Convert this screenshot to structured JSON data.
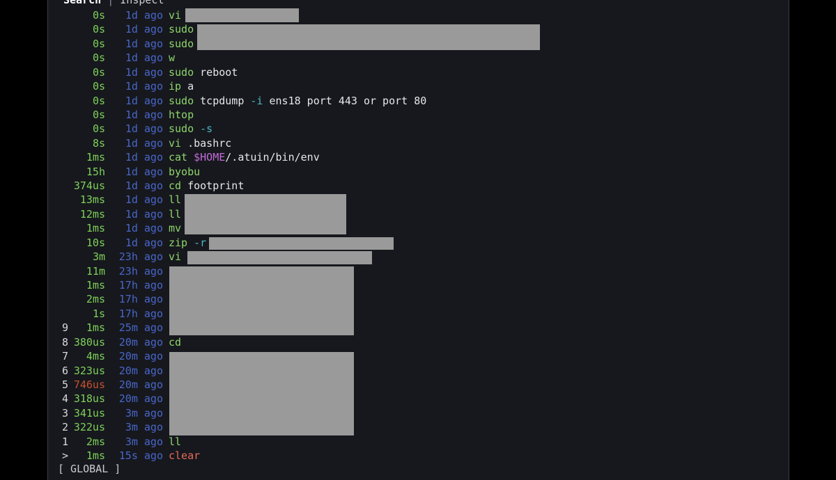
{
  "tabs": {
    "search": "Search",
    "separator": "|",
    "inspect": "Inspect"
  },
  "colors": {
    "background": "#16181d",
    "duration": "#7fd15a",
    "duration_slow": "#c9502f",
    "ago": "#4a66c9",
    "command": "#8fd56b",
    "flag": "#4fb7c4",
    "variable": "#c36bd8",
    "redaction": "#9a9a9a"
  },
  "history": [
    {
      "idx": "",
      "dur": "0s",
      "ago": "1d ago",
      "cmd": "vi"
    },
    {
      "idx": "",
      "dur": "0s",
      "ago": "1d ago",
      "cmd": "sudo"
    },
    {
      "idx": "",
      "dur": "0s",
      "ago": "1d ago",
      "cmd": "sudo"
    },
    {
      "idx": "",
      "dur": "0s",
      "ago": "1d ago",
      "cmd": "w"
    },
    {
      "idx": "",
      "dur": "0s",
      "ago": "1d ago",
      "cmd": "sudo",
      "arg": "reboot"
    },
    {
      "idx": "",
      "dur": "0s",
      "ago": "1d ago",
      "cmd": "ip",
      "arg": "a"
    },
    {
      "idx": "",
      "dur": "0s",
      "ago": "1d ago",
      "cmd": "sudo",
      "arg": "tcpdump",
      "flag": "-i",
      "rest": "ens18 port 443 or port 80"
    },
    {
      "idx": "",
      "dur": "0s",
      "ago": "1d ago",
      "cmd": "htop"
    },
    {
      "idx": "",
      "dur": "0s",
      "ago": "1d ago",
      "cmd": "sudo",
      "flag": "-s"
    },
    {
      "idx": "",
      "dur": "8s",
      "ago": "1d ago",
      "cmd": "vi",
      "arg": ".bashrc"
    },
    {
      "idx": "",
      "dur": "1ms",
      "ago": "1d ago",
      "cmd": "cat",
      "var": "$HOME",
      "rest": "/.atuin/bin/env"
    },
    {
      "idx": "",
      "dur": "15h",
      "ago": "1d ago",
      "cmd": "byobu"
    },
    {
      "idx": "",
      "dur": "374us",
      "ago": "1d ago",
      "cmd": "cd",
      "arg": "footprint"
    },
    {
      "idx": "",
      "dur": "13ms",
      "ago": "1d ago",
      "cmd": "ll"
    },
    {
      "idx": "",
      "dur": "12ms",
      "ago": "1d ago",
      "cmd": "ll"
    },
    {
      "idx": "",
      "dur": "1ms",
      "ago": "1d ago",
      "cmd": "mv"
    },
    {
      "idx": "",
      "dur": "10s",
      "ago": "1d ago",
      "cmd": "zip",
      "flag": "-r"
    },
    {
      "idx": "",
      "dur": "3m",
      "ago": "23h ago",
      "cmd": "vi"
    },
    {
      "idx": "",
      "dur": "11m",
      "ago": "23h ago",
      "cmd": ""
    },
    {
      "idx": "",
      "dur": "1ms",
      "ago": "17h ago",
      "cmd": ""
    },
    {
      "idx": "",
      "dur": "2ms",
      "ago": "17h ago",
      "cmd": ""
    },
    {
      "idx": "",
      "dur": "1s",
      "ago": "17h ago",
      "cmd": ""
    },
    {
      "idx": "9",
      "dur": "1ms",
      "ago": "25m ago",
      "cmd": ""
    },
    {
      "idx": "8",
      "dur": "380us",
      "ago": "20m ago",
      "cmd": "cd"
    },
    {
      "idx": "7",
      "dur": "4ms",
      "ago": "20m ago",
      "cmd": ""
    },
    {
      "idx": "6",
      "dur": "323us",
      "ago": "20m ago",
      "cmd": ""
    },
    {
      "idx": "5",
      "dur": "746us",
      "ago": "20m ago",
      "cmd": "",
      "slow": true
    },
    {
      "idx": "4",
      "dur": "318us",
      "ago": "20m ago",
      "cmd": ""
    },
    {
      "idx": "3",
      "dur": "341us",
      "ago": "3m ago",
      "cmd": ""
    },
    {
      "idx": "2",
      "dur": "322us",
      "ago": "3m ago",
      "cmd": ""
    },
    {
      "idx": "1",
      "dur": "2ms",
      "ago": "3m ago",
      "cmd": "ll"
    },
    {
      "idx": ">",
      "dur": "1ms",
      "ago": "15s ago",
      "cmd": "clear",
      "cmd_red": true
    }
  ],
  "status": "[ GLOBAL ]"
}
